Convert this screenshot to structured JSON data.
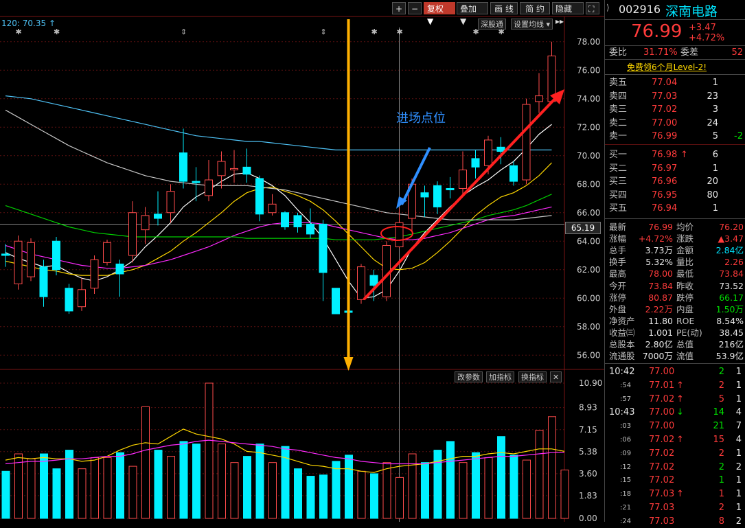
{
  "toolbar": {
    "plus": "+",
    "minus": "−",
    "fuquan": "复权",
    "diejia": "叠加",
    "huaxian": "画 线",
    "jianyue": "简 约",
    "yincang": "隐藏"
  },
  "chart_header": {
    "ma_label": "120: 70.35",
    "shengu": "深股通",
    "setting": "设置均线"
  },
  "annotations": {
    "entry_text": "进场点位",
    "price_marker": "65.19"
  },
  "chart_data": [
    {
      "type": "candlestick",
      "ylim": [
        55,
        79
      ],
      "y_ticks": [
        "78.00",
        "76.00",
        "74.00",
        "72.00",
        "70.00",
        "68.00",
        "66.00",
        "64.00",
        "62.00",
        "60.00",
        "58.00",
        "56.00"
      ],
      "candles": [
        {
          "o": 63.1,
          "c": 63.0,
          "h": 63.8,
          "l": 62.2
        },
        {
          "o": 61.0,
          "c": 64.0,
          "h": 64.4,
          "l": 60.6
        },
        {
          "o": 61.5,
          "c": 63.9,
          "h": 64.2,
          "l": 61.2
        },
        {
          "o": 62.2,
          "c": 60.1,
          "h": 62.7,
          "l": 59.4
        },
        {
          "o": 64.0,
          "c": 62.0,
          "h": 64.3,
          "l": 61.6
        },
        {
          "o": 60.7,
          "c": 59.1,
          "h": 61.0,
          "l": 58.9
        },
        {
          "o": 59.4,
          "c": 60.6,
          "h": 61.4,
          "l": 59.1
        },
        {
          "o": 60.7,
          "c": 62.7,
          "h": 63.0,
          "l": 60.3
        },
        {
          "o": 62.5,
          "c": 63.9,
          "h": 64.1,
          "l": 62.3
        },
        {
          "o": 62.4,
          "c": 61.7,
          "h": 62.7,
          "l": 60.1
        },
        {
          "o": 63.0,
          "c": 66.0,
          "h": 66.8,
          "l": 62.5
        },
        {
          "o": 64.8,
          "c": 65.8,
          "h": 66.4,
          "l": 63.8
        },
        {
          "o": 65.9,
          "c": 65.6,
          "h": 67.5,
          "l": 65.1
        },
        {
          "o": 66.0,
          "c": 67.5,
          "h": 68.0,
          "l": 65.3
        },
        {
          "o": 70.2,
          "c": 68.2,
          "h": 71.9,
          "l": 67.7
        },
        {
          "o": 68.2,
          "c": 68.1,
          "h": 69.2,
          "l": 66.8
        },
        {
          "o": 67.2,
          "c": 68.3,
          "h": 69.7,
          "l": 66.8
        },
        {
          "o": 68.6,
          "c": 69.6,
          "h": 70.3,
          "l": 67.7
        },
        {
          "o": 69.0,
          "c": 69.1,
          "h": 70.4,
          "l": 68.1
        },
        {
          "o": 69.2,
          "c": 68.7,
          "h": 70.5,
          "l": 68.1
        },
        {
          "o": 68.4,
          "c": 65.9,
          "h": 68.6,
          "l": 65.4
        },
        {
          "o": 66.0,
          "c": 66.6,
          "h": 67.3,
          "l": 65.8
        },
        {
          "o": 66.0,
          "c": 65.0,
          "h": 66.1,
          "l": 64.8
        },
        {
          "o": 65.8,
          "c": 65.0,
          "h": 66.0,
          "l": 64.6
        },
        {
          "o": 65.2,
          "c": 64.5,
          "h": 66.3,
          "l": 64.2
        },
        {
          "o": 65.2,
          "c": 61.8,
          "h": 65.5,
          "l": 59.8
        },
        {
          "o": 60.7,
          "c": 58.9,
          "h": 60.7,
          "l": 58.9
        },
        {
          "o": 59.1,
          "c": 59.0,
          "h": 59.2,
          "l": 58.9
        },
        {
          "o": 59.9,
          "c": 62.2,
          "h": 62.4,
          "l": 59.6
        },
        {
          "o": 61.6,
          "c": 60.9,
          "h": 62.0,
          "l": 59.8
        },
        {
          "o": 60.1,
          "c": 63.7,
          "h": 64.0,
          "l": 59.8
        },
        {
          "o": 63.6,
          "c": 65.3,
          "h": 66.3,
          "l": 63.5
        },
        {
          "o": 65.6,
          "c": 68.0,
          "h": 68.4,
          "l": 64.6
        },
        {
          "o": 67.4,
          "c": 67.1,
          "h": 67.9,
          "l": 65.7
        },
        {
          "o": 67.9,
          "c": 66.4,
          "h": 68.2,
          "l": 65.9
        },
        {
          "o": 67.7,
          "c": 67.6,
          "h": 68.5,
          "l": 67.0
        },
        {
          "o": 67.7,
          "c": 69.0,
          "h": 70.3,
          "l": 67.3
        },
        {
          "o": 69.8,
          "c": 69.2,
          "h": 70.4,
          "l": 68.4
        },
        {
          "o": 69.3,
          "c": 71.1,
          "h": 71.4,
          "l": 68.7
        },
        {
          "o": 70.6,
          "c": 70.3,
          "h": 71.3,
          "l": 69.4
        },
        {
          "o": 69.3,
          "c": 68.2,
          "h": 69.6,
          "l": 67.9
        },
        {
          "o": 68.3,
          "c": 73.6,
          "h": 74.0,
          "l": 68.0
        },
        {
          "o": 73.8,
          "c": 74.2,
          "h": 75.8,
          "l": 73.0
        },
        {
          "o": 73.8,
          "c": 77.0,
          "h": 78.0,
          "l": 73.7
        }
      ],
      "ma_lines": [
        {
          "name": "ma5",
          "color": "#ffffff",
          "values": [
            63.2,
            62.8,
            62.5,
            62.2,
            62.3,
            61.8,
            61.4,
            61.2,
            61.5,
            62.0,
            62.6,
            63.6,
            64.4,
            65.3,
            66.4,
            67.1,
            67.6,
            68.2,
            68.7,
            68.8,
            68.4,
            67.9,
            67.2,
            66.2,
            65.3,
            64.2,
            62.7,
            61.2,
            60.0,
            60.1,
            60.6,
            61.9,
            63.5,
            64.6,
            65.5,
            66.4,
            67.2,
            67.8,
            68.3,
            69.0,
            69.6,
            70.5,
            71.5,
            72.2
          ]
        },
        {
          "name": "ma10",
          "color": "#ffd800",
          "values": [
            62.6,
            62.4,
            62.2,
            62.0,
            61.9,
            61.7,
            61.6,
            61.6,
            61.6,
            61.8,
            62.0,
            62.3,
            62.8,
            63.3,
            64.0,
            64.6,
            65.3,
            66.0,
            66.8,
            67.4,
            67.7,
            67.8,
            67.5,
            67.2,
            66.8,
            66.2,
            65.4,
            64.5,
            63.6,
            62.7,
            62.1,
            62.0,
            62.1,
            62.5,
            63.2,
            64.0,
            64.9,
            65.8,
            66.5,
            67.1,
            67.4,
            67.9,
            68.6,
            69.5
          ]
        },
        {
          "name": "ma20",
          "color": "#ff2aff",
          "values": [
            63.7,
            63.4,
            63.1,
            62.9,
            62.7,
            62.5,
            62.3,
            62.2,
            62.1,
            62.1,
            62.2,
            62.3,
            62.5,
            62.7,
            63.0,
            63.3,
            63.6,
            64.0,
            64.4,
            64.7,
            65.0,
            65.2,
            65.3,
            65.3,
            65.3,
            65.2,
            65.0,
            64.8,
            64.6,
            64.4,
            64.2,
            64.1,
            64.1,
            64.2,
            64.4,
            64.6,
            64.9,
            65.2,
            65.5,
            65.7,
            65.8,
            66.0,
            66.2,
            66.4
          ]
        },
        {
          "name": "ma30",
          "color": "#00d000",
          "values": [
            66.5,
            66.2,
            65.9,
            65.6,
            65.3,
            65.0,
            64.8,
            64.6,
            64.5,
            64.4,
            64.3,
            64.3,
            64.3,
            64.3,
            64.3,
            64.3,
            64.3,
            64.3,
            64.3,
            64.2,
            64.2,
            64.2,
            64.2,
            64.2,
            64.2,
            64.2,
            64.1,
            64.1,
            64.1,
            64.1,
            64.2,
            64.3,
            64.5,
            64.7,
            64.9,
            65.1,
            65.3,
            65.5,
            65.8,
            66.0,
            66.2,
            66.5,
            66.9,
            67.3
          ]
        },
        {
          "name": "ma60",
          "color": "#c8c8c8",
          "values": [
            73.2,
            72.7,
            72.2,
            71.7,
            71.2,
            70.7,
            70.3,
            69.9,
            69.5,
            69.2,
            68.9,
            68.6,
            68.4,
            68.2,
            68.1,
            68.0,
            67.9,
            67.9,
            67.9,
            67.9,
            67.8,
            67.7,
            67.6,
            67.4,
            67.2,
            67.0,
            66.8,
            66.6,
            66.4,
            66.2,
            66.0,
            65.9,
            65.8,
            65.7,
            65.6,
            65.5,
            65.5,
            65.5,
            65.5,
            65.5,
            65.5,
            65.6,
            65.7,
            65.8
          ]
        },
        {
          "name": "ma120",
          "color": "#4fc3f7",
          "values": [
            74.2,
            74.1,
            74.0,
            73.8,
            73.6,
            73.4,
            73.2,
            73.0,
            72.8,
            72.6,
            72.4,
            72.2,
            72.0,
            71.8,
            71.6,
            71.4,
            71.3,
            71.2,
            71.1,
            71.0,
            71.0,
            70.9,
            70.8,
            70.7,
            70.6,
            70.5,
            70.4,
            70.4,
            70.4,
            70.4,
            70.4,
            70.4,
            70.4,
            70.4,
            70.4,
            70.4,
            70.4,
            70.4,
            70.4,
            70.4,
            70.4,
            70.4,
            70.4,
            70.4
          ]
        }
      ]
    },
    {
      "type": "bar",
      "ylim": [
        0,
        10.9
      ],
      "y_ticks": [
        "10.90",
        "8.93",
        "7.15",
        "5.38",
        "3.60",
        "1.83",
        "0.00"
      ],
      "volumes": [
        3.8,
        5.2,
        4.8,
        5.2,
        4.0,
        5.5,
        4.0,
        4.9,
        4.9,
        5.3,
        4.2,
        9.0,
        5.5,
        5.0,
        6.2,
        6.0,
        10.9,
        6.0,
        4.5,
        5.0,
        6.0,
        4.5,
        5.8,
        4.0,
        3.4,
        3.5,
        4.6,
        5.1,
        3.8,
        3.6,
        4.5,
        3.3,
        5.2,
        4.5,
        5.5,
        6.2,
        4.5,
        5.3,
        4.9,
        6.6,
        5.1,
        4.7,
        7.1,
        8.2,
        3.9
      ],
      "ma_lines": [
        {
          "name": "vol_ma1",
          "color": "#ffd800",
          "values": [
            4.7,
            4.9,
            4.8,
            4.9,
            4.8,
            4.8,
            4.6,
            4.7,
            5.0,
            5.5,
            5.9,
            6.1,
            6.0,
            6.6,
            7.2,
            6.8,
            6.6,
            6.4,
            6.0,
            5.4,
            5.3,
            5.1,
            4.9,
            4.6,
            4.3,
            4.2,
            4.0,
            4.0,
            3.8,
            3.7,
            4.0,
            4.2,
            4.3,
            4.4,
            4.6,
            4.8,
            5.0,
            5.0,
            5.2,
            5.3,
            5.2,
            5.4,
            5.6,
            5.6,
            5.4
          ]
        },
        {
          "name": "vol_ma2",
          "color": "#ff2aff",
          "values": [
            4.4,
            4.5,
            4.6,
            4.6,
            4.7,
            4.8,
            4.8,
            4.9,
            5.0,
            5.0,
            5.2,
            5.5,
            5.7,
            5.9,
            6.0,
            6.2,
            6.3,
            6.2,
            6.1,
            6.0,
            5.9,
            5.8,
            5.6,
            5.5,
            5.3,
            5.1,
            4.9,
            4.8,
            4.6,
            4.5,
            4.4,
            4.4,
            4.4,
            4.4,
            4.5,
            4.6,
            4.7,
            4.8,
            4.9,
            5.0,
            5.0,
            5.1,
            5.2,
            5.3,
            5.3
          ]
        }
      ]
    }
  ],
  "volume_toolbar": {
    "gaicanshu": "改参数",
    "jiazhibiao": "加指标",
    "huanzhibiao": "换指标",
    "close": "✕"
  },
  "panel": {
    "code": "002916",
    "name": "深南电路",
    "price": "76.99",
    "change": "+3.47",
    "change_pct": "+4.72%",
    "weibi_label": "委比",
    "weibi": "31.71%",
    "weicha_label": "委差",
    "weicha": "52",
    "promo": "免费领6个月Level-2!",
    "asks": [
      {
        "label": "卖五",
        "price": "77.04",
        "vol": "1",
        "delta": ""
      },
      {
        "label": "卖四",
        "price": "77.03",
        "vol": "23",
        "delta": ""
      },
      {
        "label": "卖三",
        "price": "77.02",
        "vol": "3",
        "delta": ""
      },
      {
        "label": "卖二",
        "price": "77.00",
        "vol": "24",
        "delta": ""
      },
      {
        "label": "卖一",
        "price": "76.99",
        "vol": "5",
        "delta": "-2"
      }
    ],
    "bids": [
      {
        "label": "买一",
        "price": "76.98",
        "arrow": "↑",
        "vol": "6"
      },
      {
        "label": "买二",
        "price": "76.97",
        "arrow": "",
        "vol": "1"
      },
      {
        "label": "买三",
        "price": "76.96",
        "arrow": "",
        "vol": "20"
      },
      {
        "label": "买四",
        "price": "76.95",
        "arrow": "",
        "vol": "80"
      },
      {
        "label": "买五",
        "price": "76.94",
        "arrow": "",
        "vol": "1"
      }
    ],
    "stats": [
      {
        "l1": "最新",
        "v1": "76.99",
        "c1": "red",
        "l2": "均价",
        "v2": "76.20",
        "c2": "red"
      },
      {
        "l1": "涨幅",
        "v1": "+4.72%",
        "c1": "red",
        "l2": "涨跌",
        "v2": "▲3.47",
        "c2": "red"
      },
      {
        "l1": "总手",
        "v1": "3.73万",
        "c1": "white",
        "l2": "金额",
        "v2": "2.84亿",
        "c2": "cyan"
      },
      {
        "l1": "换手",
        "v1": "5.32%",
        "c1": "white",
        "l2": "量比",
        "v2": "2.26",
        "c2": "red"
      },
      {
        "l1": "最高",
        "v1": "78.00",
        "c1": "red",
        "l2": "最低",
        "v2": "73.84",
        "c2": "red"
      },
      {
        "l1": "今开",
        "v1": "73.84",
        "c1": "red",
        "l2": "昨收",
        "v2": "73.52",
        "c2": "white"
      },
      {
        "l1": "涨停",
        "v1": "80.87",
        "c1": "red",
        "l2": "跌停",
        "v2": "66.17",
        "c2": "green"
      },
      {
        "l1": "外盘",
        "v1": "2.22万",
        "c1": "red",
        "l2": "内盘",
        "v2": "1.50万",
        "c2": "green"
      },
      {
        "l1": "净资产",
        "v1": "11.80",
        "c1": "white",
        "l2": "ROE",
        "v2": "8.54%",
        "c2": "white"
      },
      {
        "l1": "收益㈢",
        "v1": "1.001",
        "c1": "white",
        "l2": "PE(动)",
        "v2": "38.45",
        "c2": "white"
      },
      {
        "l1": "总股本",
        "v1": "2.80亿",
        "c1": "white",
        "l2": "总值",
        "v2": "216亿",
        "c2": "white"
      },
      {
        "l1": "流通股",
        "v1": "7000万",
        "c1": "white",
        "l2": "流值",
        "v2": "53.9亿",
        "c2": "white"
      }
    ],
    "ticks": [
      {
        "time": "10:42",
        "price": "77.00",
        "arrow": "",
        "vol": "2",
        "n": "1",
        "vc": "green"
      },
      {
        "time": ":54",
        "price": "77.01",
        "arrow": "↑",
        "vol": "2",
        "n": "1",
        "vc": "red"
      },
      {
        "time": ":57",
        "price": "77.02",
        "arrow": "↑",
        "vol": "5",
        "n": "1",
        "vc": "red"
      },
      {
        "time": "10:43",
        "price": "77.00",
        "arrow": "↓",
        "vol": "14",
        "n": "4",
        "vc": "green"
      },
      {
        "time": ":03",
        "price": "77.00",
        "arrow": "",
        "vol": "21",
        "n": "7",
        "vc": "green"
      },
      {
        "time": ":06",
        "price": "77.02",
        "arrow": "↑",
        "vol": "15",
        "n": "4",
        "vc": "red"
      },
      {
        "time": ":09",
        "price": "77.02",
        "arrow": "",
        "vol": "2",
        "n": "1",
        "vc": "red"
      },
      {
        "time": ":12",
        "price": "77.02",
        "arrow": "",
        "vol": "2",
        "n": "2",
        "vc": "green"
      },
      {
        "time": ":15",
        "price": "77.02",
        "arrow": "",
        "vol": "1",
        "n": "1",
        "vc": "green"
      },
      {
        "time": ":18",
        "price": "77.03",
        "arrow": "↑",
        "vol": "1",
        "n": "1",
        "vc": "red"
      },
      {
        "time": ":21",
        "price": "77.03",
        "arrow": "",
        "vol": "2",
        "n": "1",
        "vc": "red"
      },
      {
        "time": ":24",
        "price": "77.03",
        "arrow": "",
        "vol": "8",
        "n": "2",
        "vc": "red"
      }
    ],
    "colors": {
      "red": "#ff3b3b",
      "green": "#00e000",
      "cyan": "#00e5ff",
      "white": "#e8e8e8"
    }
  }
}
